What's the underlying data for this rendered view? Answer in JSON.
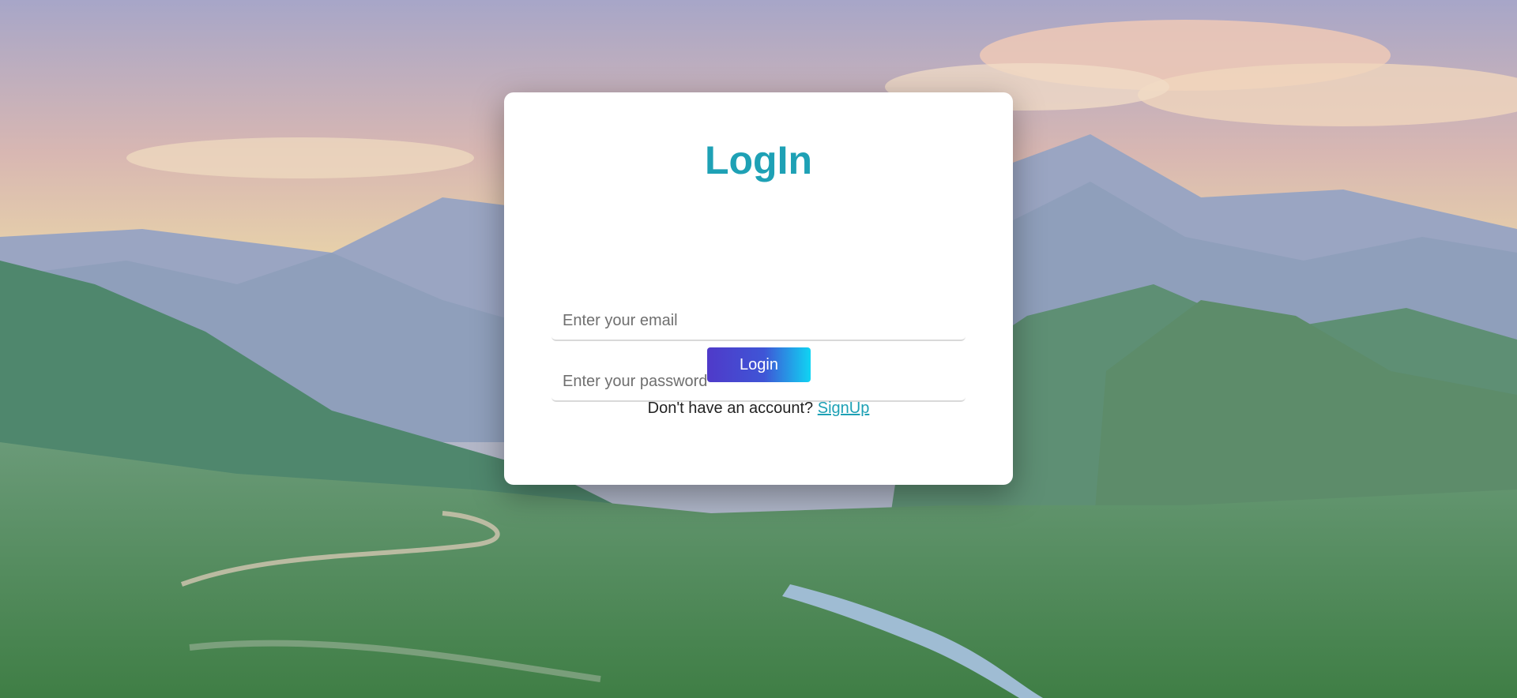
{
  "login_card": {
    "title": "LogIn",
    "email_placeholder": "Enter your email",
    "password_placeholder": "Enter your password",
    "login_button_label": "Login",
    "signup_prompt": "Don't have an account? ",
    "signup_link_label": "SignUp"
  },
  "colors": {
    "accent": "#1ea1b5",
    "button_gradient_start": "#4f3ac9",
    "button_gradient_end": "#10d4f3"
  },
  "background_image": "mountain-valley-illustration"
}
